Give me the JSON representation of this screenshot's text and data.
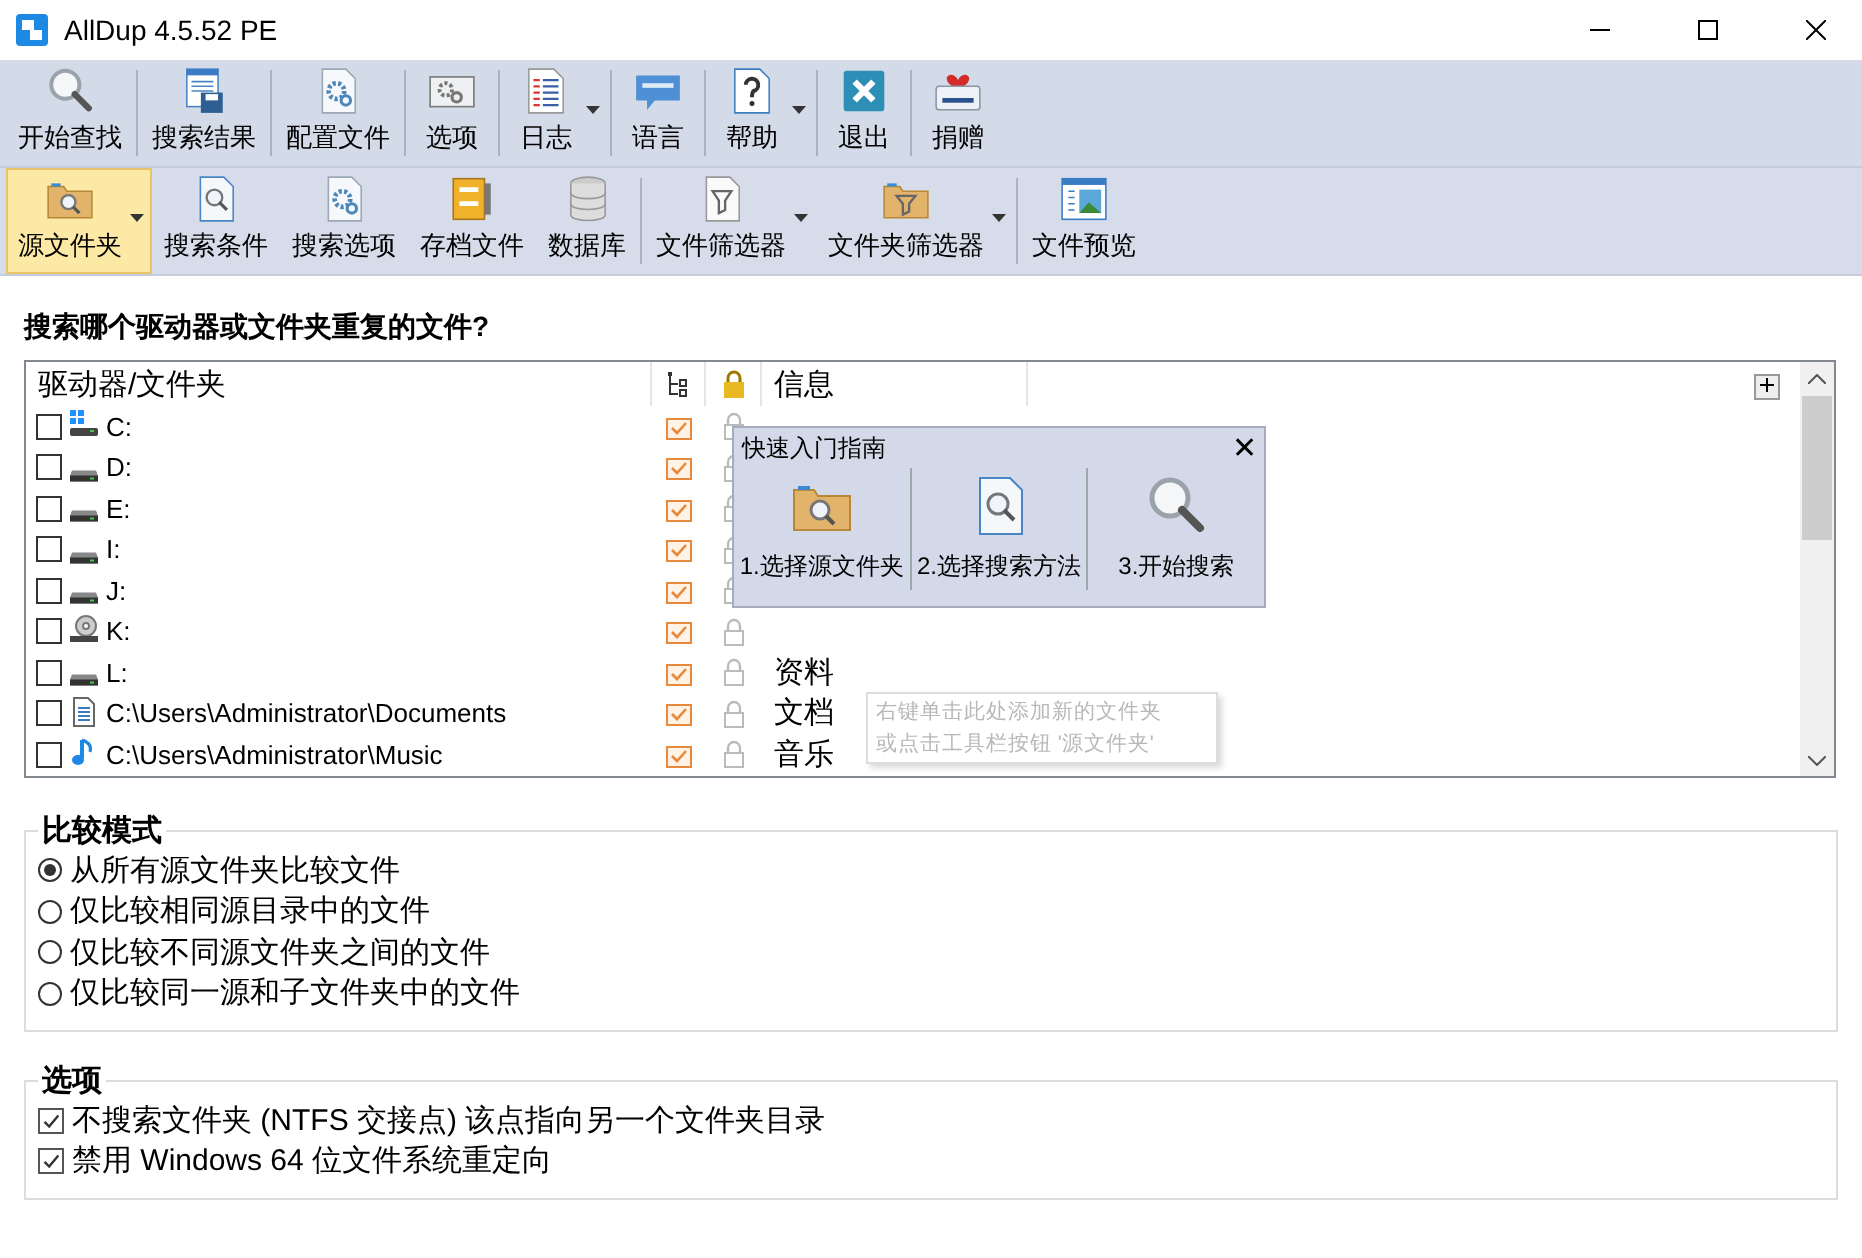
{
  "window": {
    "title": "AllDup 4.5.52 PE"
  },
  "toolbar_main": [
    {
      "label": "开始查找",
      "dropdown": false
    },
    {
      "label": "搜索结果",
      "dropdown": false
    },
    {
      "label": "配置文件",
      "dropdown": false
    },
    {
      "label": "选项",
      "dropdown": false
    },
    {
      "label": "日志",
      "dropdown": true
    },
    {
      "label": "语言",
      "dropdown": false
    },
    {
      "label": "帮助",
      "dropdown": true
    },
    {
      "label": "退出",
      "dropdown": false
    },
    {
      "label": "捐赠",
      "dropdown": false
    }
  ],
  "toolbar_source": [
    {
      "label": "源文件夹",
      "dropdown": true,
      "selected": true
    },
    {
      "label": "搜索条件",
      "dropdown": false,
      "selected": false
    },
    {
      "label": "搜索选项",
      "dropdown": false,
      "selected": false
    },
    {
      "label": "存档文件",
      "dropdown": false,
      "selected": false
    },
    {
      "label": "数据库",
      "dropdown": false,
      "selected": false
    },
    {
      "label": "文件筛选器",
      "dropdown": true,
      "selected": false
    },
    {
      "label": "文件夹筛选器",
      "dropdown": true,
      "selected": false
    },
    {
      "label": "文件预览",
      "dropdown": false,
      "selected": false
    }
  ],
  "prompt": "搜索哪个驱动器或文件夹重复的文件?",
  "source_list": {
    "columns": [
      "驱动器/文件夹",
      "信息"
    ],
    "rows": [
      {
        "path": "C:",
        "kind": "system",
        "checked": false,
        "subfolders": true,
        "locked": false
      },
      {
        "path": "D:",
        "kind": "drive",
        "checked": false,
        "subfolders": true,
        "locked": false
      },
      {
        "path": "E:",
        "kind": "drive",
        "checked": false,
        "subfolders": true,
        "locked": false
      },
      {
        "path": "I:",
        "kind": "drive",
        "checked": false,
        "subfolders": true,
        "locked": false
      },
      {
        "path": "J:",
        "kind": "drive",
        "checked": false,
        "subfolders": true,
        "locked": false
      },
      {
        "path": "K:",
        "kind": "disc",
        "checked": false,
        "subfolders": true,
        "locked": false
      },
      {
        "path": "L:",
        "kind": "drive",
        "checked": false,
        "subfolders": true,
        "locked": false,
        "info": "资料"
      },
      {
        "path": "C:\\Users\\Administrator\\Documents",
        "kind": "documents",
        "checked": false,
        "subfolders": true,
        "locked": false,
        "info": "文档"
      },
      {
        "path": "C:\\Users\\Administrator\\Music",
        "kind": "music",
        "checked": false,
        "subfolders": true,
        "locked": false,
        "info": "音乐"
      }
    ]
  },
  "quick_guide": {
    "title": "快速入门指南",
    "close": "✕",
    "steps": [
      {
        "label": "1.选择源文件夹"
      },
      {
        "label": "2.选择搜索方法"
      },
      {
        "label": "3.开始搜索"
      }
    ]
  },
  "hint": {
    "lines": [
      "右键单击此处添加新的文件夹",
      "或点击工具栏按钮 '源文件夹'"
    ]
  },
  "compare_mode": {
    "title": "比较模式",
    "options": [
      {
        "label": "从所有源文件夹比较文件",
        "selected": true
      },
      {
        "label": "仅比较相同源目录中的文件",
        "selected": false
      },
      {
        "label": "仅比较不同源文件夹之间的文件",
        "selected": false
      },
      {
        "label": "仅比较同一源和子文件夹中的文件",
        "selected": false
      }
    ]
  },
  "options": {
    "title": "选项",
    "items": [
      {
        "label": "不搜索文件夹 (NTFS 交接点) 该点指向另一个文件夹目录",
        "checked": true
      },
      {
        "label": "禁用 Windows 64 位文件系统重定向",
        "checked": true
      }
    ]
  }
}
